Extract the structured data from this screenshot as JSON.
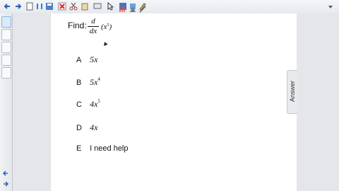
{
  "question": {
    "prompt": "Find:",
    "numerator": "d",
    "denominator": "dx",
    "expression": "(x",
    "exponent": "5",
    "close": ")"
  },
  "choices": [
    {
      "letter": "A",
      "base": "5x",
      "exp": ""
    },
    {
      "letter": "B",
      "base": "5x",
      "exp": "4"
    },
    {
      "letter": "C",
      "base": "4x",
      "exp": "5"
    },
    {
      "letter": "D",
      "base": "4x",
      "exp": ""
    },
    {
      "letter": "E",
      "text": "I need help"
    }
  ],
  "answer_tab": {
    "label": "Answer"
  },
  "colors": {
    "gutter": "#e4e6ea",
    "toolbar": "#e6e9ee",
    "accent": "#3a78c9"
  },
  "toolbar_icons": [
    "back-arrow-icon",
    "forward-arrow-icon",
    "page-icon",
    "sort-icon",
    "save-icon",
    "delete-icon",
    "cut-icon",
    "paste-icon",
    "screen-icon",
    "select-icon",
    "table-icon",
    "fill-icon",
    "pen-icon",
    "highlighter-icon",
    "shape-icon",
    "line-icon",
    "more-icon"
  ],
  "sidebar_icons": [
    "page-sorter-icon",
    "gallery-icon",
    "attachments-icon",
    "properties-icon",
    "addons-icon"
  ]
}
